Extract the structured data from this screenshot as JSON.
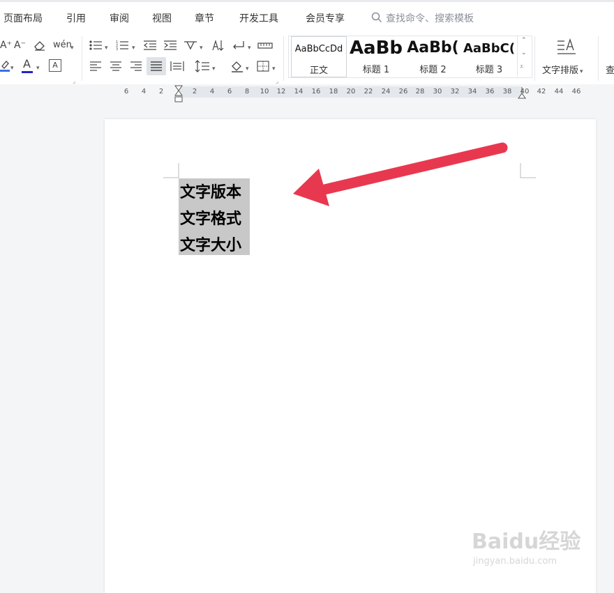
{
  "menu": {
    "items": [
      "页面布局",
      "引用",
      "审阅",
      "视图",
      "章节",
      "开发工具",
      "会员专享"
    ],
    "search_placeholder": "查找命令、搜索模板"
  },
  "ribbon": {
    "icons": {
      "grow_font": "A⁺",
      "shrink_font": "A⁻",
      "clear_format": "eraser-icon",
      "phonetic": "wén",
      "highlight": "highlight-icon",
      "font_color": "A",
      "char_border": "A",
      "bullets": "bullet-list-icon",
      "numbering": "numbered-list-icon",
      "decrease_indent": "decrease-indent-icon",
      "increase_indent": "increase-indent-icon",
      "chinese_layout": "chinese-layout-icon",
      "sort": "sort-icon",
      "show_marks": "paragraph-marks-icon",
      "table_layout": "ruler-icon",
      "align_left": "align-left-icon",
      "align_center": "align-center-icon",
      "align_right": "align-right-icon",
      "justify": "justify-icon",
      "distribute": "distribute-icon",
      "line_spacing": "line-spacing-icon",
      "shading": "shading-icon",
      "borders": "borders-icon"
    },
    "styles": [
      {
        "sample": "AaBbCcDd",
        "name": "正文"
      },
      {
        "sample": "AaBb",
        "name": "标题 1"
      },
      {
        "sample": "AaBb(",
        "name": "标题 2"
      },
      {
        "sample": "AaBbC(",
        "name": "标题 3"
      }
    ],
    "text_layout_label": "文字排版",
    "find_label": "查"
  },
  "ruler": {
    "numbers": [
      "6",
      "4",
      "2",
      "2",
      "4",
      "6",
      "8",
      "10",
      "12",
      "14",
      "16",
      "18",
      "20",
      "22",
      "24",
      "26",
      "28",
      "30",
      "32",
      "34",
      "36",
      "38",
      "40",
      "42",
      "44",
      "46"
    ]
  },
  "document": {
    "lines": [
      "文字版本",
      "文字格式",
      "文字大小"
    ]
  },
  "annotation": {
    "arrow_color": "#e8384f"
  },
  "watermark": {
    "main": "Baidu经验",
    "sub": "jingyan.baidu.com"
  },
  "colors": {
    "selection": "#c8c8c8",
    "font_color_bar": "#2323cc",
    "highlight_bar": "#3a6ee8"
  }
}
